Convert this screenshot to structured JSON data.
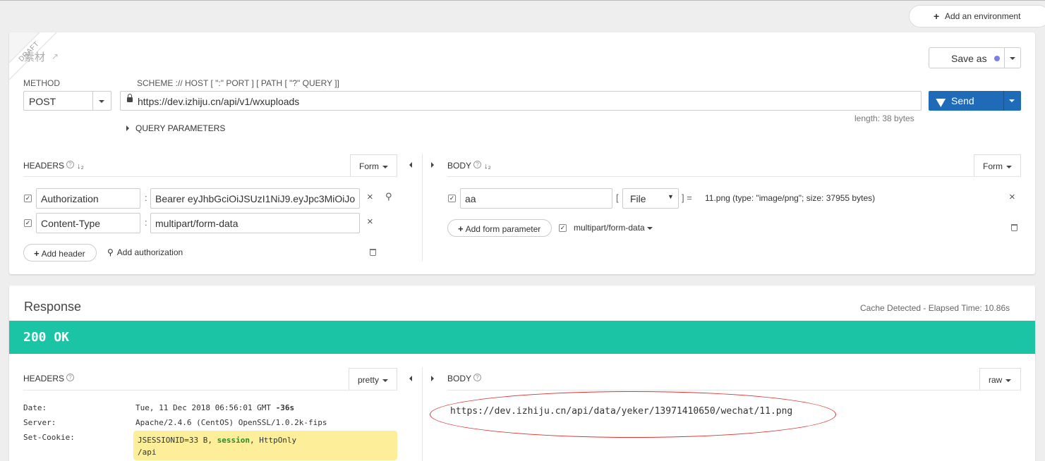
{
  "top": {
    "add_env_label": "Add an environment"
  },
  "request": {
    "ribbon": "DRAFT",
    "title": "素材",
    "save_as": "Save as",
    "method_label": "METHOD",
    "scheme_label": "SCHEME :// HOST [ \":\" PORT ] [ PATH [ \"?\" QUERY ]]",
    "method": "POST",
    "url": "https://dev.izhiju.cn/api/v1/wxuploads",
    "send": "Send",
    "length": "length: 38 bytes",
    "query_params": "QUERY PARAMETERS",
    "headers": {
      "label": "HEADERS",
      "mode": "Form",
      "rows": [
        {
          "name": "Authorization",
          "value": "Bearer eyJhbGciOiJSUzI1NiJ9.eyJpc3MiOiJo",
          "checked": true
        },
        {
          "name": "Content-Type",
          "value": "multipart/form-data",
          "checked": true
        }
      ],
      "add_header": "Add header",
      "add_authorization": "Add authorization"
    },
    "body": {
      "label": "BODY",
      "mode": "Form",
      "param_name": "aa",
      "bracket_open": "[",
      "param_type": "File",
      "bracket_close": "] =",
      "file_info": "11.png (type: \"image/png\"; size: 37955 bytes)",
      "add_form_param": "Add form parameter",
      "encoding": "multipart/form-data"
    }
  },
  "response": {
    "title": "Response",
    "cache": "Cache Detected - Elapsed Time: 10.86s",
    "status": "200 OK",
    "headers": {
      "label": "HEADERS",
      "mode": "pretty",
      "rows": [
        {
          "key": "Date:",
          "value": "Tue, 11 Dec 2018 06:56:01 GMT",
          "extra": "-36s"
        },
        {
          "key": "Server:",
          "value": "Apache/2.4.6 (CentOS) OpenSSL/1.0.2k-fips"
        },
        {
          "key": "Set-Cookie:",
          "value_part1": "JSESSIONID=33 B, ",
          "value_bold": "session",
          "value_part2": ", HttpOnly",
          "value_line2": "/api"
        }
      ]
    },
    "body": {
      "label": "BODY",
      "mode": "raw",
      "text": "https://dev.izhiju.cn/api/data/yeker/13971410650/wechat/11.png"
    }
  },
  "colors": {
    "status_bg": "#1bc4a5",
    "send_bg": "#1f6bb8",
    "cookie_highlight": "#fdee99",
    "annotation": "#dd3333"
  }
}
